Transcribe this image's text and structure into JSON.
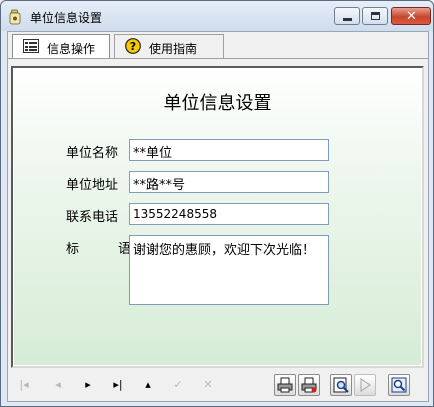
{
  "window": {
    "title": "单位信息设置",
    "minimize_label": "",
    "close_glyph": "✕"
  },
  "tabs": [
    {
      "label": "信息操作",
      "icon": "form-icon",
      "active": true
    },
    {
      "label": "使用指南",
      "icon": "help-icon",
      "active": false
    }
  ],
  "form": {
    "heading": "单位信息设置",
    "fields": [
      {
        "label": "单位名称",
        "value": "**单位"
      },
      {
        "label": "单位地址",
        "value": "**路**号"
      },
      {
        "label": "联系电话",
        "value": "13552248558"
      }
    ],
    "remark": {
      "label_first": "标",
      "label_second": "语",
      "value": "谢谢您的惠顾，欢迎下次光临！"
    }
  },
  "toolbar": {
    "nav": [
      {
        "name": "first-record-button",
        "glyph": "|◂",
        "enabled": false
      },
      {
        "name": "previous-record-button",
        "glyph": "◂",
        "enabled": false
      },
      {
        "name": "next-record-button",
        "glyph": "▸",
        "enabled": true
      },
      {
        "name": "last-record-button",
        "glyph": "▸|",
        "enabled": true
      },
      {
        "name": "insert-record-button",
        "glyph": "▴",
        "enabled": true
      },
      {
        "name": "post-record-button",
        "glyph": "✓",
        "enabled": false
      },
      {
        "name": "cancel-record-button",
        "glyph": "✕",
        "enabled": false
      }
    ],
    "icons": [
      "print-icon",
      "print-setup-icon",
      "preview-icon",
      "play-icon",
      "search-icon"
    ]
  },
  "colors": {
    "panel_gradient_top": "#ffffff",
    "panel_gradient_bottom": "#d6ecd6",
    "close_button": "#c8452c"
  }
}
